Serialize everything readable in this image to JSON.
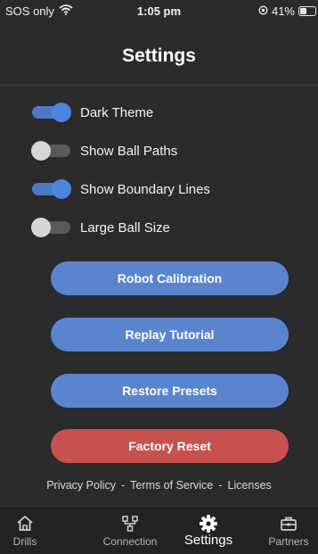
{
  "status_bar": {
    "carrier": "SOS only",
    "time": "1:05 pm",
    "battery": "41%",
    "battery_level": 0.41
  },
  "header": {
    "title": "Settings"
  },
  "toggles": [
    {
      "label": "Dark Theme",
      "on": true
    },
    {
      "label": "Show Ball Paths",
      "on": false
    },
    {
      "label": "Show Boundary Lines",
      "on": true
    },
    {
      "label": "Large Ball Size",
      "on": false
    }
  ],
  "buttons": {
    "robot_calibration": "Robot Calibration",
    "replay_tutorial": "Replay Tutorial",
    "restore_presets": "Restore Presets",
    "factory_reset": "Factory Reset"
  },
  "links": {
    "privacy": "Privacy Policy",
    "terms": "Terms of Service",
    "licenses": "Licenses",
    "separator": "-"
  },
  "tabs": [
    {
      "label": "Drills",
      "icon": "home-icon",
      "active": false
    },
    {
      "label": "Connection",
      "icon": "network-icon",
      "active": false
    },
    {
      "label": "Settings",
      "icon": "gear-icon",
      "active": true
    },
    {
      "label": "Partners",
      "icon": "briefcase-icon",
      "active": false
    }
  ],
  "colors": {
    "background": "#2b2b2d",
    "primary_button": "#5b84cf",
    "danger_button": "#c8504e",
    "toggle_on": "#4a86e0"
  }
}
